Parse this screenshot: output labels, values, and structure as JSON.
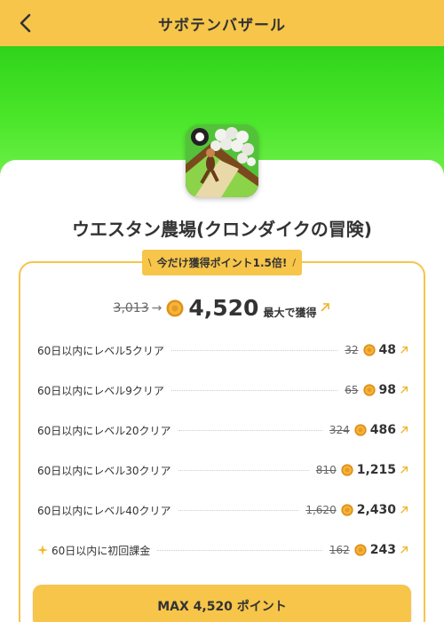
{
  "header": {
    "title": "サボテンバザール",
    "back_icon": "chevron-left-icon"
  },
  "app": {
    "name": "ウエスタン農場(クロンダイクの冒険)",
    "icon": "farm-game-icon"
  },
  "promo": {
    "left_mark": "\\",
    "text": "今だけ獲得ポイント1.5倍!",
    "right_mark": "/"
  },
  "total": {
    "old": "3,013",
    "arrow": "→",
    "new": "4,520",
    "suffix": "最大で獲得"
  },
  "rows": [
    {
      "label": "60日以内にレベル5クリア",
      "old": "32",
      "new": "48"
    },
    {
      "label": "60日以内にレベル9クリア",
      "old": "65",
      "new": "98"
    },
    {
      "label": "60日以内にレベル20クリア",
      "old": "324",
      "new": "486"
    },
    {
      "label": "60日以内にレベル30クリア",
      "old": "810",
      "new": "1,215"
    },
    {
      "label": "60日以内にレベル40クリア",
      "old": "1,620",
      "new": "2,430"
    },
    {
      "label": "60日以内に初回課金",
      "old": "162",
      "new": "243"
    }
  ],
  "button": {
    "label": "MAX 4,520 ポイント"
  },
  "colors": {
    "accent": "#f6c54a",
    "banner": "#3edc1f",
    "coin": "#f0a020"
  }
}
